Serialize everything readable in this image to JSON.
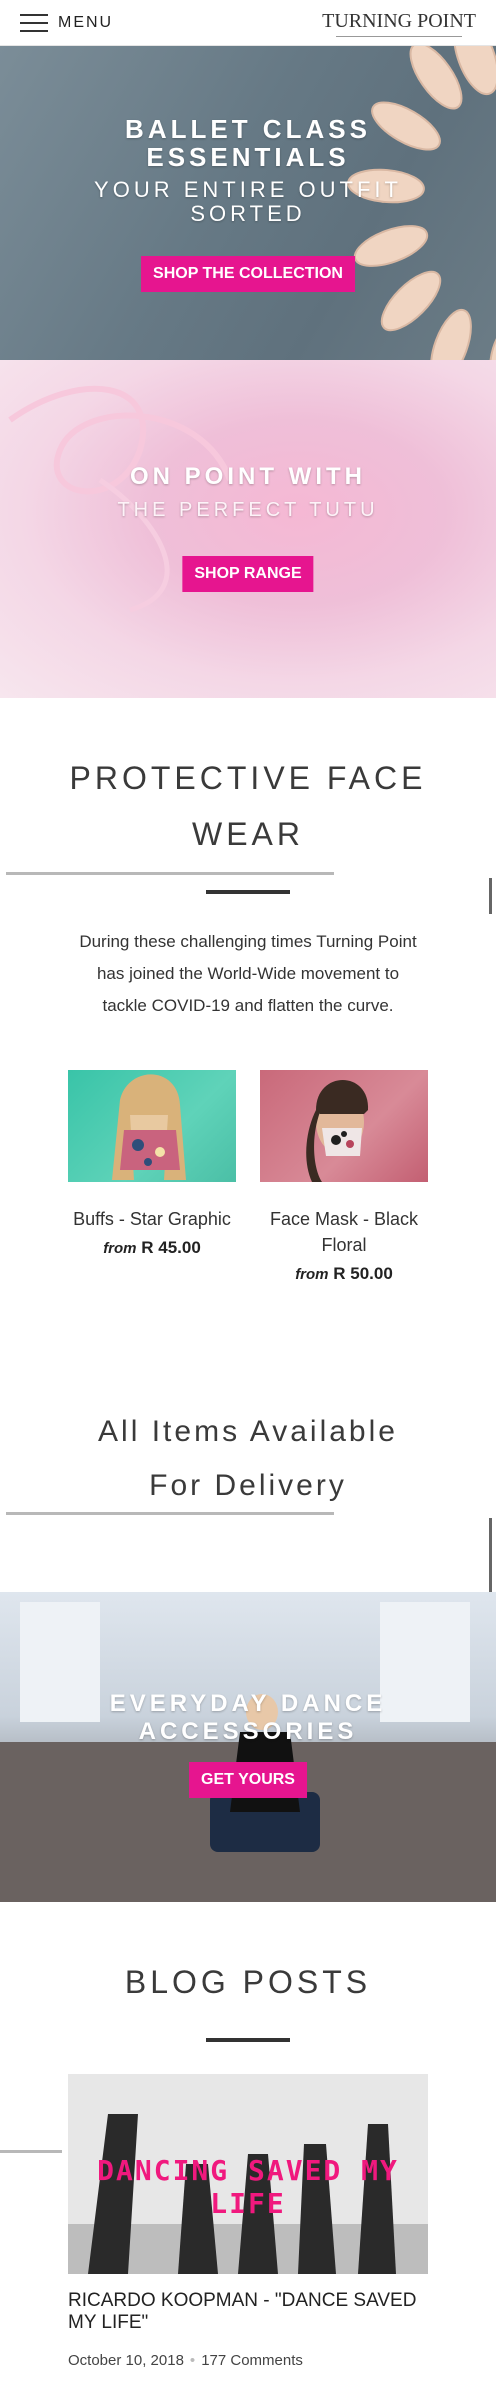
{
  "header": {
    "menu_label": "MENU",
    "logo_text": "TURNING POINT"
  },
  "banners": [
    {
      "title_line1": "BALLET CLASS",
      "title_line2": "ESSENTIALS",
      "subtitle_line1": "YOUR ENTIRE OUTFIT",
      "subtitle_line2": "SORTED",
      "button": "SHOP THE COLLECTION"
    },
    {
      "title_line1": "ON POINT WITH",
      "subtitle_line1": "THE PERFECT TUTU",
      "button": "SHOP RANGE"
    },
    {
      "title_line1": "EVERYDAY DANCE",
      "title_line2": "ACCESSORIES",
      "button": "GET YOURS"
    }
  ],
  "face_wear": {
    "title_line1": "PROTECTIVE FACE",
    "title_line2": "WEAR",
    "description_lines": [
      "During these challenging times Turning Point",
      "has joined the World-Wide movement to",
      "tackle COVID-19 and flatten the curve."
    ],
    "products": [
      {
        "name_line1": "Buffs - Star Graphic",
        "name_line2": "",
        "from": "from",
        "price": "R 45.00"
      },
      {
        "name_line1": "Face Mask - Black",
        "name_line2": "Floral",
        "from": "from",
        "price": "R 50.00"
      }
    ]
  },
  "delivery": {
    "title_line1": "All Items Available",
    "title_line2": "For Delivery"
  },
  "blog": {
    "section_title": "BLOG POSTS",
    "image_caption": "DANCING SAVED MY LIFE",
    "post_title": "RICARDO KOOPMAN - \"DANCE SAVED MY LIFE\"",
    "date": "October 10, 2018",
    "comments": "177 Comments"
  },
  "colors": {
    "accent": "#e6158f",
    "text": "#333333"
  }
}
